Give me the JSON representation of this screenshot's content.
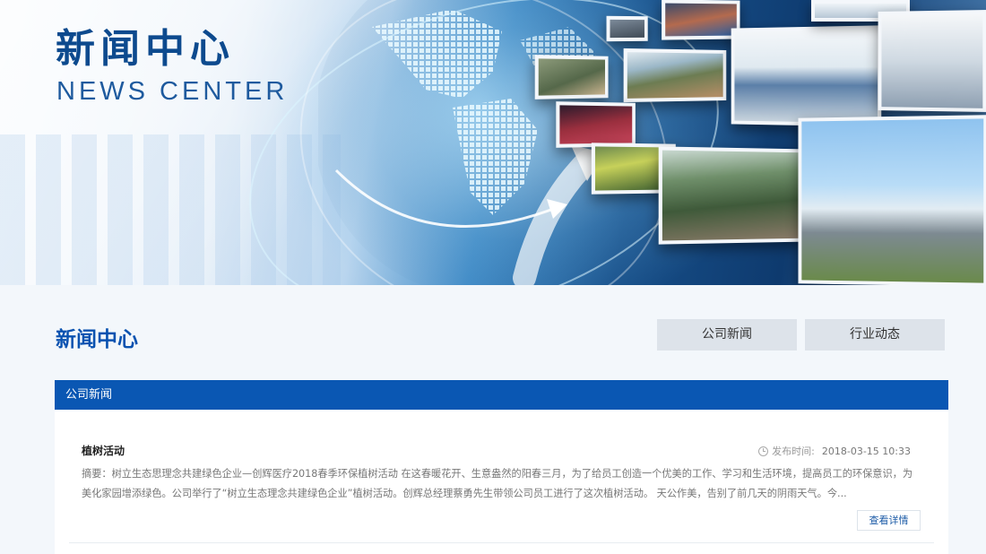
{
  "banner": {
    "title_cn": "新闻中心",
    "title_en": "NEWS CENTER"
  },
  "section": {
    "title": "新闻中心",
    "tabs": [
      {
        "label": "公司新闻"
      },
      {
        "label": "行业动态"
      }
    ]
  },
  "panel": {
    "header": "公司新闻",
    "items": [
      {
        "title": "植树活动",
        "date_label": "发布时间:",
        "date": "2018-03-15 10:33",
        "summary": "摘要：树立生态思理念共建绿色企业—创辉医疗2018春季环保植树活动 在这春暖花开、生意盎然的阳春三月，为了给员工创造一个优美的工作、学习和生活环境，提高员工的环保意识，为美化家园增添绿色。公司举行了“树立生态理念共建绿色企业”植树活动。创辉总经理蔡勇先生带领公司员工进行了这次植树活动。 天公作美，告别了前几天的阴雨天气。今...",
        "detail_label": "查看详情"
      }
    ]
  },
  "colors": {
    "brand_blue": "#0a57b3",
    "title_blue": "#0a52b0",
    "tab_bg": "#dde3ea",
    "page_bg": "#f3f7fb"
  },
  "icons": {
    "date": "clock-icon"
  }
}
